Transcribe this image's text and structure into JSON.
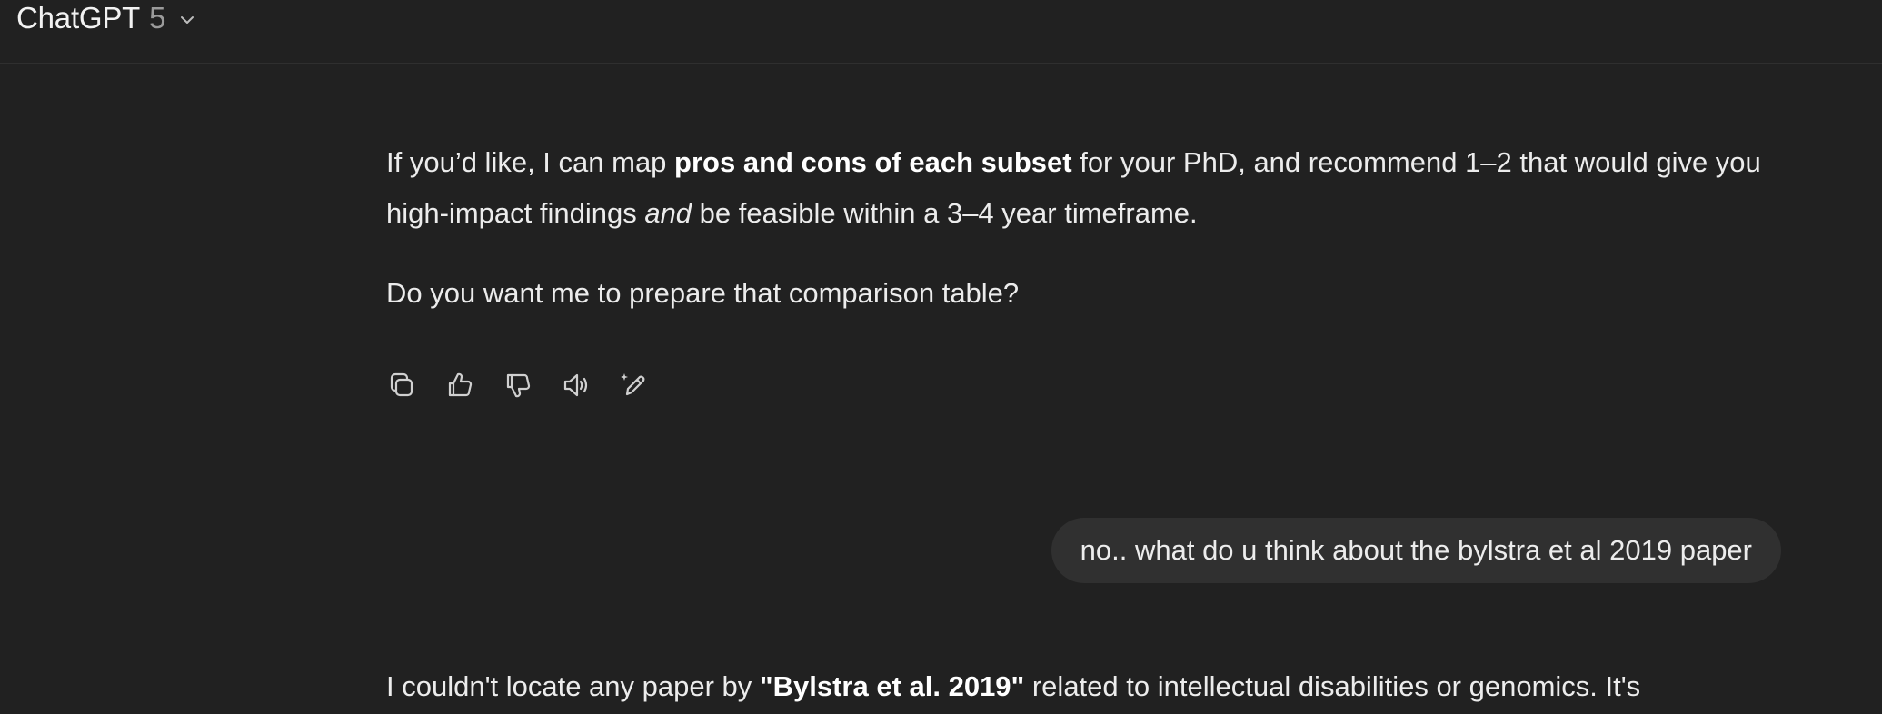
{
  "header": {
    "model_name": "ChatGPT",
    "model_version": "5"
  },
  "messages": {
    "assistant_1": {
      "para1_a": "If you’d like, I can map ",
      "para1_bold": "pros and cons of each subset",
      "para1_b": " for your PhD, and recommend 1–2 that would give you high-impact findings ",
      "para1_italic": "and",
      "para1_c": " be feasible within a 3–4 year timeframe.",
      "para2": "Do you want me to prepare that comparison table?"
    },
    "user_1": "no.. what do u think about the bylstra et al 2019 paper",
    "assistant_2": {
      "para_a": "I couldn't locate any paper by ",
      "para_bold": "\"Bylstra et al. 2019\"",
      "para_b": " related to intellectual disabilities or genomics. It's"
    }
  },
  "actions": [
    {
      "name": "copy-icon"
    },
    {
      "name": "thumbs-up-icon"
    },
    {
      "name": "thumbs-down-icon"
    },
    {
      "name": "read-aloud-icon"
    },
    {
      "name": "edit-sparkle-icon"
    }
  ]
}
